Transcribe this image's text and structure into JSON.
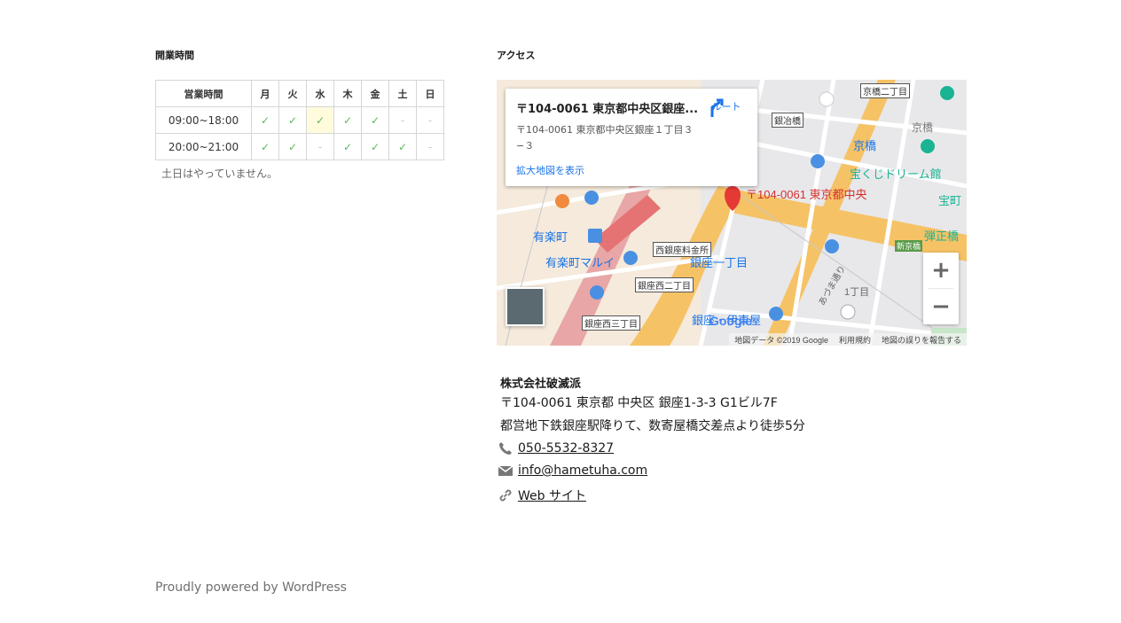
{
  "hours_widget": {
    "title": "開業時間",
    "header_label": "営業時間",
    "days": [
      "月",
      "火",
      "水",
      "木",
      "金",
      "土",
      "日"
    ],
    "rows": [
      {
        "time": "09:00~18:00",
        "marks": [
          "✓",
          "✓",
          "✓",
          "✓",
          "✓",
          "-",
          "-"
        ]
      },
      {
        "time": "20:00~21:00",
        "marks": [
          "✓",
          "✓",
          "-",
          "✓",
          "✓",
          "✓",
          "-"
        ]
      }
    ],
    "today_index": 2,
    "note": "土日はやっていません。"
  },
  "access_widget": {
    "title": "アクセス",
    "map": {
      "info_title": "〒104-0061 東京都中央区銀座...",
      "info_address": "〒104-0061 東京都中央区銀座１丁目３−３",
      "route_label": "ルート",
      "larger_map_link": "拡大地図を表示",
      "marker_label": "〒104-0061 東京都中央",
      "zoom_in": "+",
      "zoom_out": "−",
      "google_logo": "Google",
      "footer_data": "地図データ ©2019 Google",
      "footer_terms": "利用規約",
      "footer_report": "地図の誤りを報告する",
      "labels": {
        "yurakucho": "有楽町",
        "yurakucho_marui": "有楽町マルイ",
        "ginza_itchome": "銀座一丁目",
        "kyobashi": "京橋",
        "kyobashi_small": "京橋",
        "takarakuji": "宝くじドリーム館",
        "nishiginza_ryokin": "西銀座料金所",
        "ginza_nishi_2": "銀座西二丁目",
        "ginza_nishi_3": "銀座西三丁目",
        "ginza_itou": "銀座・伊東屋",
        "kyobashi_2": "京橋二丁目",
        "ginyabashi": "銀冶橋",
        "shin_kyobashi": "新京橋",
        "tamaCho": "宝町",
        "yaibashi": "弾正橋",
        "itchome": "1丁目",
        "azuma_dori": "あづま通り"
      }
    },
    "contact": {
      "company": "株式会社破滅派",
      "address": "〒104-0061 東京都 中央区 銀座1-3-3 G1ビル7F",
      "directions": "都営地下鉄銀座駅降りて、数寄屋橋交差点より徒歩5分",
      "phone": "050-5532-8327",
      "email": "info@hametuha.com",
      "web": "Web サイト"
    }
  },
  "footer": {
    "powered_by": "Proudly powered by WordPress"
  }
}
